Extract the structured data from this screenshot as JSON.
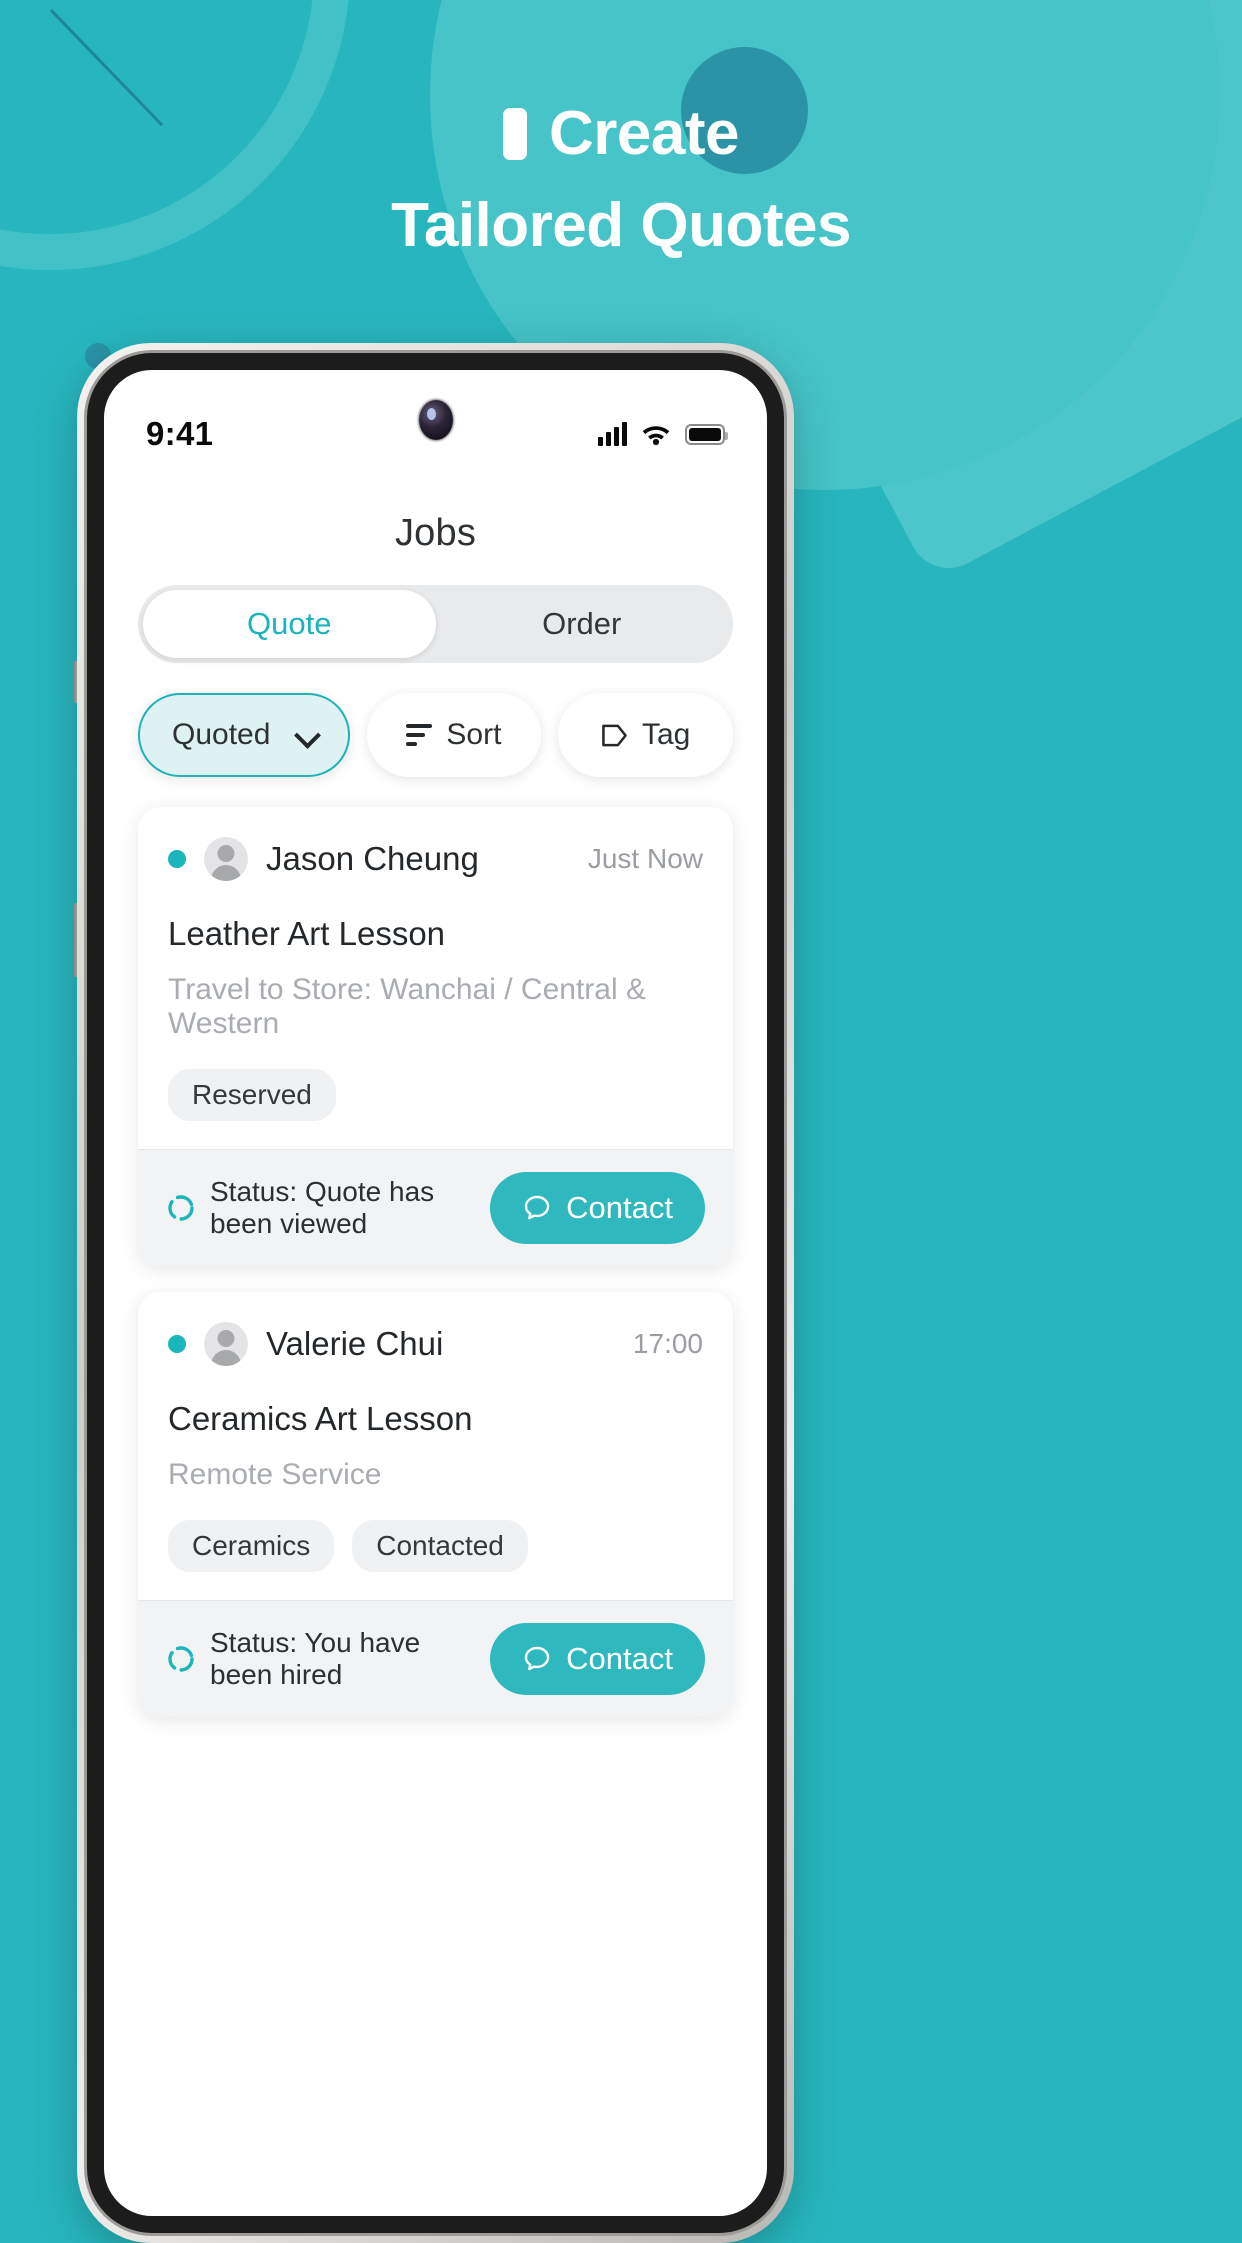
{
  "promo": {
    "line1": "Create",
    "line2": "Tailored Quotes"
  },
  "colors": {
    "background": "#27b6bd",
    "accent": "#1cb5bb",
    "circle_light": "#46c4c8",
    "circle_dark": "#2a94a6",
    "contact_button": "#2fb8bd"
  },
  "statusbar": {
    "time": "9:41",
    "signal_icon": "signal-bars-icon",
    "wifi_icon": "wifi-icon",
    "battery_icon": "battery-icon"
  },
  "app": {
    "title": "Jobs",
    "segments": [
      {
        "label": "Quote",
        "active": true
      },
      {
        "label": "Order",
        "active": false
      }
    ],
    "filters": [
      {
        "label": "Quoted",
        "type": "dropdown",
        "icon": "chevron-down-icon",
        "active": true
      },
      {
        "label": "Sort",
        "type": "button",
        "icon": "sort-icon",
        "active": false
      },
      {
        "label": "Tag",
        "type": "button",
        "icon": "tag-icon",
        "active": false
      }
    ],
    "jobs": [
      {
        "customer": "Jason Cheung",
        "time": "Just Now",
        "title": "Leather Art Lesson",
        "subtitle": "Travel to Store: Wanchai / Central & Western",
        "tags": [
          "Reserved"
        ],
        "status": "Status: Quote has been viewed",
        "action": "Contact"
      },
      {
        "customer": "Valerie Chui",
        "time": "17:00",
        "title": "Ceramics Art Lesson",
        "subtitle": "Remote Service",
        "tags": [
          "Ceramics",
          "Contacted"
        ],
        "status": "Status: You have been hired",
        "action": "Contact"
      }
    ]
  }
}
